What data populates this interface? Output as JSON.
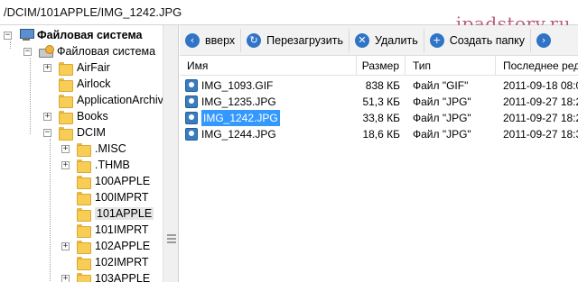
{
  "path": "/DCIM/101APPLE/IMG_1242.JPG",
  "watermark": "ipadstory.ru",
  "tree": {
    "root": "Файловая система",
    "drive": "Файловая система",
    "folders": [
      {
        "label": "AirFair",
        "expandable": true
      },
      {
        "label": "Airlock",
        "expandable": false
      },
      {
        "label": "ApplicationArchive",
        "expandable": false
      },
      {
        "label": "Books",
        "expandable": true
      },
      {
        "label": "DCIM",
        "expandable": true,
        "expanded": true
      }
    ],
    "dcim_children": [
      {
        "label": ".MISC",
        "expandable": true
      },
      {
        "label": ".THMB",
        "expandable": true
      },
      {
        "label": "100APPLE",
        "expandable": false
      },
      {
        "label": "100IMPRT",
        "expandable": false
      },
      {
        "label": "101APPLE",
        "expandable": false,
        "selected": true
      },
      {
        "label": "101IMPRT",
        "expandable": false
      },
      {
        "label": "102APPLE",
        "expandable": true
      },
      {
        "label": "102IMPRT",
        "expandable": false
      },
      {
        "label": "103APPLE",
        "expandable": true
      }
    ]
  },
  "toolbar": {
    "up": "вверх",
    "reload": "Перезагрузить",
    "delete": "Удалить",
    "new_folder": "Создать папку"
  },
  "columns": {
    "name": "Имя",
    "size": "Размер",
    "type": "Тип",
    "modified": "Последнее ред"
  },
  "files": [
    {
      "name": "IMG_1093.GIF",
      "size": "838 КБ",
      "type": "Файл \"GIF\"",
      "modified": "2011-09-18 08:0",
      "selected": false
    },
    {
      "name": "IMG_1235.JPG",
      "size": "51,3 КБ",
      "type": "Файл \"JPG\"",
      "modified": "2011-09-27 18:2",
      "selected": false
    },
    {
      "name": "IMG_1242.JPG",
      "size": "33,8 КБ",
      "type": "Файл \"JPG\"",
      "modified": "2011-09-27 18:2",
      "selected": true
    },
    {
      "name": "IMG_1244.JPG",
      "size": "18,6 КБ",
      "type": "Файл \"JPG\"",
      "modified": "2011-09-27 18:3",
      "selected": false
    }
  ],
  "colors": {
    "selection": "#3399ff",
    "icon_blue": "#2f74c6",
    "watermark": "#b85d7d"
  },
  "icons": {
    "up": "arrow-left-icon",
    "reload": "refresh-icon",
    "delete": "close-icon",
    "new_folder": "new-folder-icon",
    "next": "next-icon"
  }
}
